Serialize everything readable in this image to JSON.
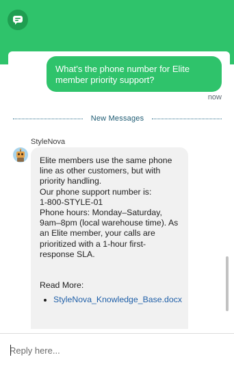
{
  "header": {
    "logo_icon": "chat-bubble-icon",
    "accent_color": "#2fc36b"
  },
  "conversation": {
    "user_message": {
      "text": "What's the phone number for Elite member priority support?",
      "timestamp": "now"
    },
    "divider_label": "New Messages",
    "bot": {
      "name": "StyleNova",
      "avatar_icon": "robot-avatar-icon",
      "lines": [
        "Elite members use the same phone line as other customers, but with priority handling.",
        "Our phone support number is:",
        "1-800-STYLE-01",
        "Phone hours: Monday–Saturday, 9am–8pm (local warehouse time). As an Elite member, your calls are prioritized with a 1-hour first-response SLA."
      ],
      "read_more_label": "Read More:",
      "links": [
        "StyleNova_Knowledge_Base.docx"
      ]
    }
  },
  "composer": {
    "placeholder": "Reply here..."
  }
}
